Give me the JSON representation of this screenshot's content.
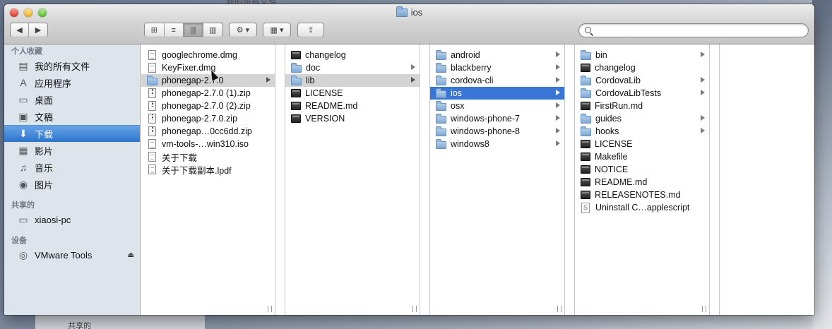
{
  "background": {
    "title": "我的所有文件",
    "bottom_label": "共享的"
  },
  "window": {
    "title": "ios",
    "traffic": [
      "close",
      "minimize",
      "zoom"
    ]
  },
  "toolbar": {
    "nav": {
      "back": "◀",
      "forward": "▶"
    },
    "views": [
      {
        "name": "icon-view",
        "glyph": "⊞"
      },
      {
        "name": "list-view",
        "glyph": "≡"
      },
      {
        "name": "column-view",
        "glyph": "|||",
        "active": true
      },
      {
        "name": "coverflow-view",
        "glyph": "▥"
      }
    ],
    "action_glyph": "⚙ ▾",
    "arrange_glyph": "▦ ▾",
    "share_glyph": "⇪",
    "search_placeholder": ""
  },
  "sidebar": {
    "sections": [
      {
        "header": "个人收藏",
        "items": [
          {
            "label": "我的所有文件",
            "icon": "all-files-icon",
            "glyph": "▤"
          },
          {
            "label": "应用程序",
            "icon": "applications-icon",
            "glyph": "A"
          },
          {
            "label": "桌面",
            "icon": "desktop-icon",
            "glyph": "▭"
          },
          {
            "label": "文稿",
            "icon": "documents-icon",
            "glyph": "▣"
          },
          {
            "label": "下载",
            "icon": "downloads-icon",
            "glyph": "⬇",
            "selected": true
          },
          {
            "label": "影片",
            "icon": "movies-icon",
            "glyph": "▦"
          },
          {
            "label": "音乐",
            "icon": "music-icon",
            "glyph": "♫"
          },
          {
            "label": "图片",
            "icon": "pictures-icon",
            "glyph": "◉"
          }
        ]
      },
      {
        "header": "共享的",
        "items": [
          {
            "label": "xiaosi-pc",
            "icon": "computer-icon",
            "glyph": "▭"
          }
        ]
      },
      {
        "header": "设备",
        "items": [
          {
            "label": "VMware Tools",
            "icon": "disc-icon",
            "glyph": "◎",
            "eject": "⏏"
          }
        ]
      }
    ]
  },
  "columns": [
    {
      "items": [
        {
          "label": "googlechrome.dmg",
          "type": "doc"
        },
        {
          "label": "KeyFixer.dmg",
          "type": "doc"
        },
        {
          "label": "phonegap-2.7.0",
          "type": "folder",
          "arrow": true,
          "selected": "gray"
        },
        {
          "label": "phonegap-2.7.0 (1).zip",
          "type": "zip"
        },
        {
          "label": "phonegap-2.7.0 (2).zip",
          "type": "zip"
        },
        {
          "label": "phonegap-2.7.0.zip",
          "type": "zip"
        },
        {
          "label": "phonegap…0cc6dd.zip",
          "type": "zip"
        },
        {
          "label": "vm-tools-…win310.iso",
          "type": "doc"
        },
        {
          "label": "关于下载",
          "type": "doc"
        },
        {
          "label": "关于下载副本.lpdf",
          "type": "doc"
        }
      ]
    },
    {
      "items": [
        {
          "label": "changelog",
          "type": "exec"
        },
        {
          "label": "doc",
          "type": "folder",
          "arrow": true
        },
        {
          "label": "lib",
          "type": "folder",
          "arrow": true,
          "selected": "gray"
        },
        {
          "label": "LICENSE",
          "type": "exec"
        },
        {
          "label": "README.md",
          "type": "exec"
        },
        {
          "label": "VERSION",
          "type": "exec"
        }
      ]
    },
    {
      "items": [
        {
          "label": "android",
          "type": "folder",
          "arrow": true
        },
        {
          "label": "blackberry",
          "type": "folder",
          "arrow": true
        },
        {
          "label": "cordova-cli",
          "type": "folder",
          "arrow": true
        },
        {
          "label": "ios",
          "type": "folder",
          "arrow": true,
          "selected": "blue"
        },
        {
          "label": "osx",
          "type": "folder",
          "arrow": true
        },
        {
          "label": "windows-phone-7",
          "type": "folder",
          "arrow": true
        },
        {
          "label": "windows-phone-8",
          "type": "folder",
          "arrow": true
        },
        {
          "label": "windows8",
          "type": "folder",
          "arrow": true
        }
      ]
    },
    {
      "items": [
        {
          "label": "bin",
          "type": "folder",
          "arrow": true
        },
        {
          "label": "changelog",
          "type": "exec"
        },
        {
          "label": "CordovaLib",
          "type": "folder",
          "arrow": true
        },
        {
          "label": "CordovaLibTests",
          "type": "folder",
          "arrow": true
        },
        {
          "label": "FirstRun.md",
          "type": "exec"
        },
        {
          "label": "guides",
          "type": "folder",
          "arrow": true
        },
        {
          "label": "hooks",
          "type": "folder",
          "arrow": true
        },
        {
          "label": "LICENSE",
          "type": "exec"
        },
        {
          "label": "Makefile",
          "type": "exec"
        },
        {
          "label": "NOTICE",
          "type": "exec"
        },
        {
          "label": "README.md",
          "type": "exec"
        },
        {
          "label": "RELEASENOTES.md",
          "type": "exec"
        },
        {
          "label": "Uninstall C…applescript",
          "type": "script"
        }
      ]
    },
    {
      "items": []
    }
  ]
}
